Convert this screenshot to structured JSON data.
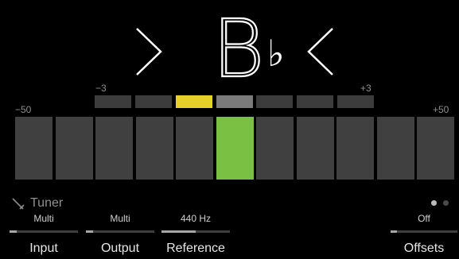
{
  "tuner": {
    "note": "B",
    "accidental": "♭",
    "fine_scale": {
      "min": "−3",
      "max": "+3"
    },
    "coarse_scale": {
      "min": "−50",
      "max": "+50"
    },
    "fine_active_index": 2,
    "fine_center_index": 3,
    "coarse_active_index": 5,
    "colors": {
      "fine_active": "#e6d02a",
      "fine_center": "#7b7b7b",
      "coarse_active": "#7ac143",
      "segment": "#404040"
    }
  },
  "footer": {
    "title": "Tuner",
    "page_indicator": {
      "total": 2,
      "current": 1
    },
    "params": [
      {
        "label": "Input",
        "value": "Multi",
        "level": 0.1
      },
      {
        "label": "Output",
        "value": "Multi",
        "level": 0.1
      },
      {
        "label": "Reference",
        "value": "440 Hz",
        "level": 0.5
      },
      {
        "label": "Offsets",
        "value": "Off",
        "level": 0.1
      }
    ]
  }
}
